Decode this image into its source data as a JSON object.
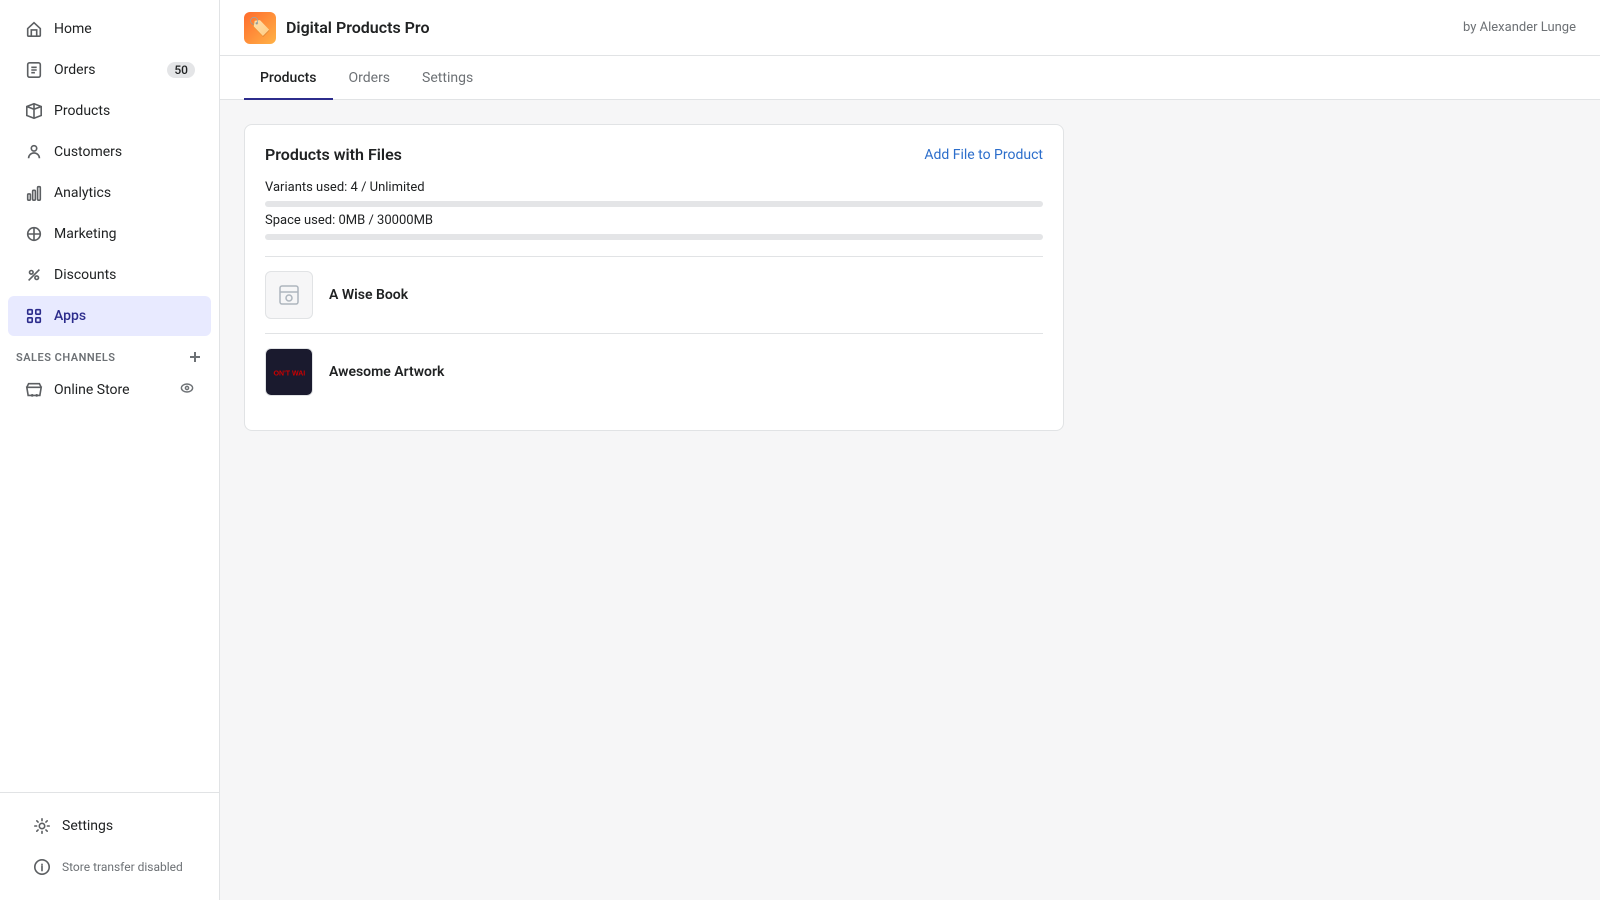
{
  "sidebar": {
    "items": [
      {
        "id": "home",
        "label": "Home",
        "icon": "home-icon",
        "active": false,
        "badge": null
      },
      {
        "id": "orders",
        "label": "Orders",
        "icon": "orders-icon",
        "active": false,
        "badge": "50"
      },
      {
        "id": "products",
        "label": "Products",
        "icon": "products-icon",
        "active": false,
        "badge": null
      },
      {
        "id": "customers",
        "label": "Customers",
        "icon": "customers-icon",
        "active": false,
        "badge": null
      },
      {
        "id": "analytics",
        "label": "Analytics",
        "icon": "analytics-icon",
        "active": false,
        "badge": null
      },
      {
        "id": "marketing",
        "label": "Marketing",
        "icon": "marketing-icon",
        "active": false,
        "badge": null
      },
      {
        "id": "discounts",
        "label": "Discounts",
        "icon": "discounts-icon",
        "active": false,
        "badge": null
      },
      {
        "id": "apps",
        "label": "Apps",
        "icon": "apps-icon",
        "active": true,
        "badge": null
      }
    ],
    "sales_channels_label": "SALES CHANNELS",
    "sales_channels": [
      {
        "id": "online-store",
        "label": "Online Store",
        "icon": "store-icon"
      }
    ],
    "settings_label": "Settings",
    "store_transfer_label": "Store transfer disabled"
  },
  "header": {
    "app_icon": "🏷️",
    "app_title": "Digital Products Pro",
    "author": "by Alexander Lunge"
  },
  "tabs": [
    {
      "id": "products",
      "label": "Products",
      "active": true
    },
    {
      "id": "orders",
      "label": "Orders",
      "active": false
    },
    {
      "id": "settings",
      "label": "Settings",
      "active": false
    }
  ],
  "card": {
    "title": "Products with Files",
    "add_file_label": "Add File to Product",
    "variants_used": "Variants used: 4 / Unlimited",
    "space_used": "Space used: 0MB / 30000MB",
    "variants_progress": 0,
    "space_progress": 0,
    "products": [
      {
        "id": "a-wise-book",
        "name": "A Wise Book",
        "has_image": false
      },
      {
        "id": "awesome-artwork",
        "name": "Awesome Artwork",
        "has_image": true
      }
    ]
  }
}
